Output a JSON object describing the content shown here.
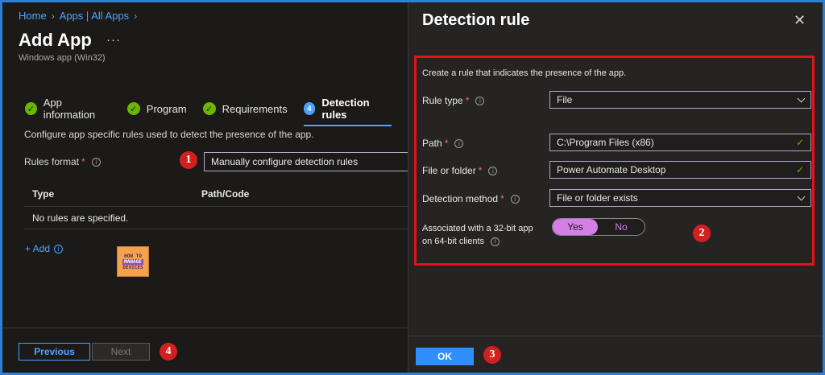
{
  "breadcrumb": {
    "items": [
      "Home",
      "Apps | All Apps"
    ]
  },
  "page": {
    "title": "Add App",
    "more": "···",
    "subtitle": "Windows app (Win32)"
  },
  "steps": [
    {
      "label": "App information",
      "state": "done"
    },
    {
      "label": "Program",
      "state": "done"
    },
    {
      "label": "Requirements",
      "state": "done"
    },
    {
      "label": "Detection rules",
      "state": "active",
      "number": "4"
    }
  ],
  "left": {
    "description": "Configure app specific rules used to detect the presence of the app.",
    "rules_format_label": "Rules format",
    "rules_format_value": "Manually configure detection rules",
    "table": {
      "col_type": "Type",
      "col_path": "Path/Code",
      "empty": "No rules are specified."
    },
    "add_label": "+ Add",
    "logo": {
      "line1": "HOW TO",
      "line2": "MANAGE",
      "line3": "DEVICES"
    },
    "previous_label": "Previous",
    "next_label": "Next"
  },
  "panel": {
    "title": "Detection rule",
    "close": "✕",
    "intro": "Create a rule that indicates the presence of the app.",
    "rule_type_label": "Rule type",
    "rule_type_value": "File",
    "path_label": "Path",
    "path_value": "C:\\Program Files (x86)",
    "file_label": "File or folder",
    "file_value": "Power Automate Desktop",
    "method_label": "Detection method",
    "method_value": "File or folder exists",
    "assoc_line1": "Associated with a 32-bit app",
    "assoc_line2": "on 64-bit clients",
    "toggle_yes": "Yes",
    "toggle_no": "No",
    "ok_label": "OK"
  },
  "markers": {
    "m1": "1",
    "m2": "2",
    "m3": "3",
    "m4": "4"
  },
  "colors": {
    "accent": "#4da3ff",
    "success": "#6bb700",
    "highlight": "#e3121b",
    "toggle": "#d67ee8"
  }
}
